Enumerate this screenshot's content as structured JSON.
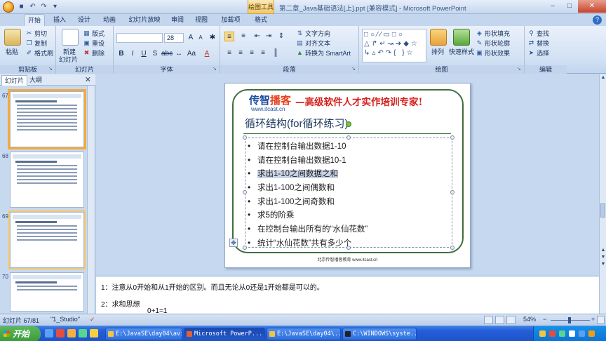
{
  "titlebar": {
    "context_tab": "绘图工具",
    "title": "第二章_Java基础语法[上].ppt [兼容模式] - Microsoft PowerPoint"
  },
  "tabs": [
    "开始",
    "插入",
    "设计",
    "动画",
    "幻灯片放映",
    "审阅",
    "视图",
    "加载项",
    "格式"
  ],
  "ribbon": {
    "clipboard": {
      "label": "剪贴板",
      "paste": "粘贴",
      "cut": "剪切",
      "copy": "复制",
      "format_painter": "格式刷"
    },
    "slides": {
      "label": "幻灯片",
      "new_slide": "新建",
      "new_slide2": "幻灯片",
      "layout": "版式",
      "reset": "重设",
      "delete": "删除"
    },
    "font": {
      "label": "字体",
      "font_name": "",
      "font_size": "28"
    },
    "paragraph": {
      "label": "段落",
      "text_direction": "文字方向",
      "align_text": "对齐文本",
      "smartart": "转换为 SmartArt"
    },
    "drawing": {
      "label": "绘图",
      "arrange": "排列",
      "quick_styles": "快速样式",
      "shape_fill": "形状填充",
      "shape_outline": "形状轮廓",
      "shape_effects": "形状效果"
    },
    "editing": {
      "label": "编辑",
      "find": "查找",
      "replace": "替换",
      "select": "选择"
    }
  },
  "left_pane": {
    "tab_slides": "幻灯片",
    "tab_outline": "大纲",
    "thumbnails": [
      {
        "number": "67"
      },
      {
        "number": "68"
      },
      {
        "number": "69"
      },
      {
        "number": "70"
      }
    ]
  },
  "slide": {
    "logo": {
      "part1": "传智",
      "part2": "播客",
      "url": "www.itcast.cn"
    },
    "slogan": "—高级软件人才实作培训专家!",
    "title": "循环结构(for循环练习)",
    "bullets": [
      "请在控制台输出数据1-10",
      "请在控制台输出数据10-1",
      "求出1-10之间数据之和",
      "求出1-100之间偶数和",
      "求出1-100之间奇数和",
      "求5的阶乘",
      "在控制台输出所有的“水仙花数”",
      "统计“水仙花数”共有多少个"
    ],
    "footer": "北京传智播客教育 www.itcast.cn"
  },
  "notes": {
    "line1": "1：注意从0开始和从1开始的区别。而且无论从0还是1开始都是可以的。",
    "line2": "2：求和思想",
    "line3": "0+1=1"
  },
  "statusbar": {
    "slide_position": "幻灯片 67/81",
    "theme": "\"1_Studio\"",
    "zoom": "54%"
  },
  "taskbar": {
    "start": "开始",
    "tasks": [
      "E:\\JavaSE\\day04\\avi",
      "Microsoft PowerP...",
      "E:\\JavaSE\\day04\\...",
      "C:\\WINDOWS\\syste..."
    ]
  },
  "colors": {
    "ribbon_bg": "#d2e1f4",
    "selected_thumb": "#f6a93b",
    "slogan_red": "#d6201c",
    "logo_blue": "#1e4fa0",
    "taskbar_blue": "#245edb"
  }
}
